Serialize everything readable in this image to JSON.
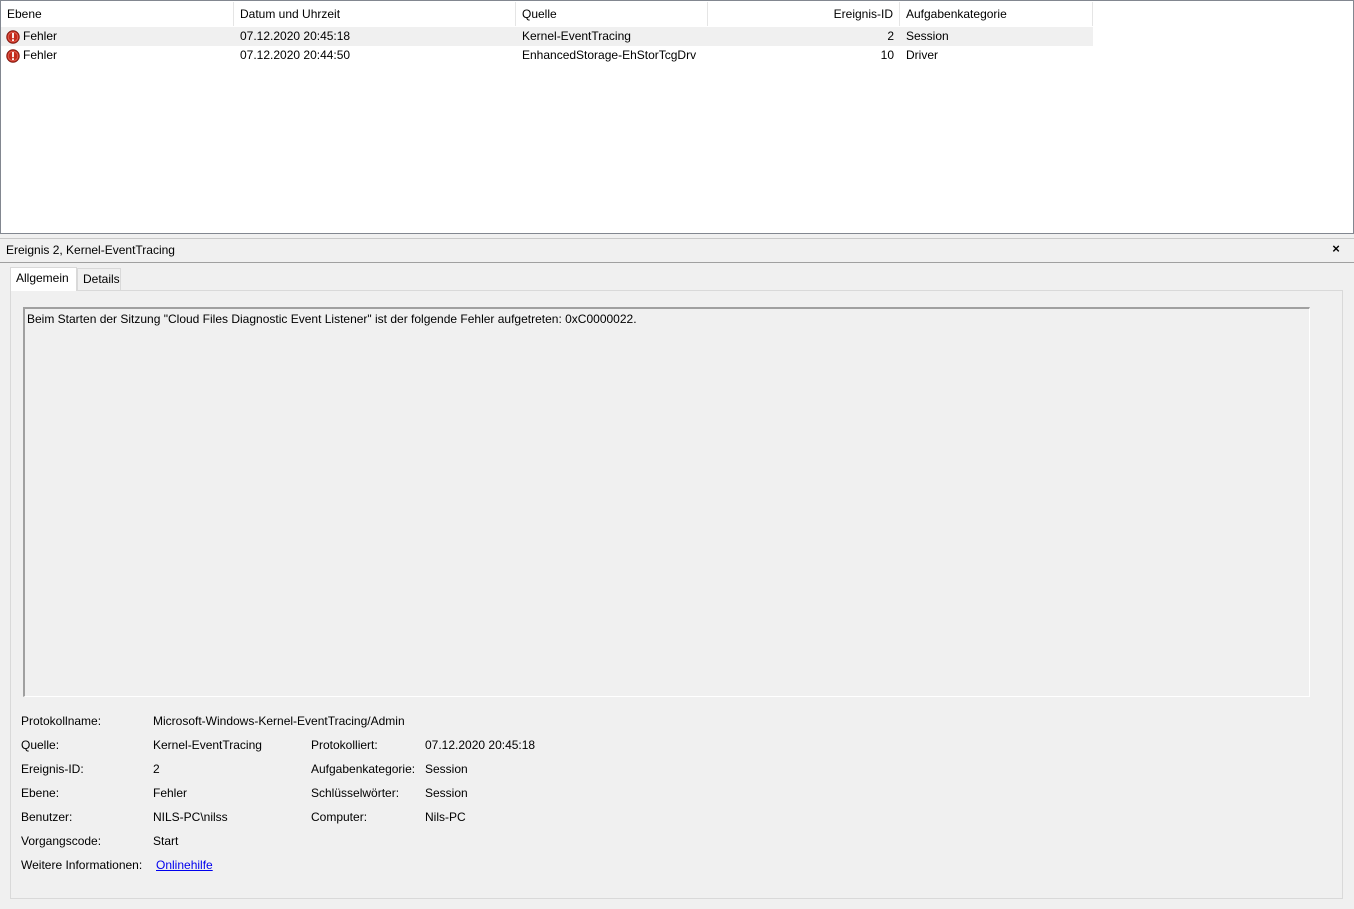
{
  "columns": {
    "level": "Ebene",
    "datetime": "Datum und Uhrzeit",
    "source": "Quelle",
    "event_id": "Ereignis-ID",
    "category": "Aufgabenkategorie"
  },
  "events": [
    {
      "level": "Fehler",
      "level_icon": "error-icon",
      "datetime": "07.12.2020 20:45:18",
      "source": "Kernel-EventTracing",
      "event_id": "2",
      "category": "Session",
      "selected": true
    },
    {
      "level": "Fehler",
      "level_icon": "error-icon",
      "datetime": "07.12.2020 20:44:50",
      "source": "EnhancedStorage-EhStorTcgDrv",
      "event_id": "10",
      "category": "Driver",
      "selected": false
    }
  ],
  "detail": {
    "title": "Ereignis 2, Kernel-EventTracing",
    "close_glyph": "×",
    "tabs": [
      {
        "label": "Allgemein",
        "active": true
      },
      {
        "label": "Details",
        "active": false
      }
    ],
    "description": "Beim Starten der Sitzung \"Cloud Files Diagnostic Event Listener\" ist der folgende Fehler aufgetreten: 0xC0000022.",
    "properties": {
      "log_name_label": "Protokollname:",
      "log_name": "Microsoft-Windows-Kernel-EventTracing/Admin",
      "source_label": "Quelle:",
      "source": "Kernel-EventTracing",
      "logged_label": "Protokolliert:",
      "logged": "07.12.2020 20:45:18",
      "event_id_label": "Ereignis-ID:",
      "event_id": "2",
      "task_category_label": "Aufgabenkategorie:",
      "task_category": "Session",
      "level_label": "Ebene:",
      "level": "Fehler",
      "keywords_label": "Schlüsselwörter:",
      "keywords": "Session",
      "user_label": "Benutzer:",
      "user": "NILS-PC\\nilss",
      "computer_label": "Computer:",
      "computer": "Nils-PC",
      "opcode_label": "Vorgangscode:",
      "opcode": "Start",
      "more_info_label": "Weitere Informationen:",
      "more_info_link": "Onlinehilfe"
    }
  },
  "colors": {
    "link": "#0000ee",
    "error_icon": "#c42b1c",
    "selected_row": "#f0f0f0"
  }
}
